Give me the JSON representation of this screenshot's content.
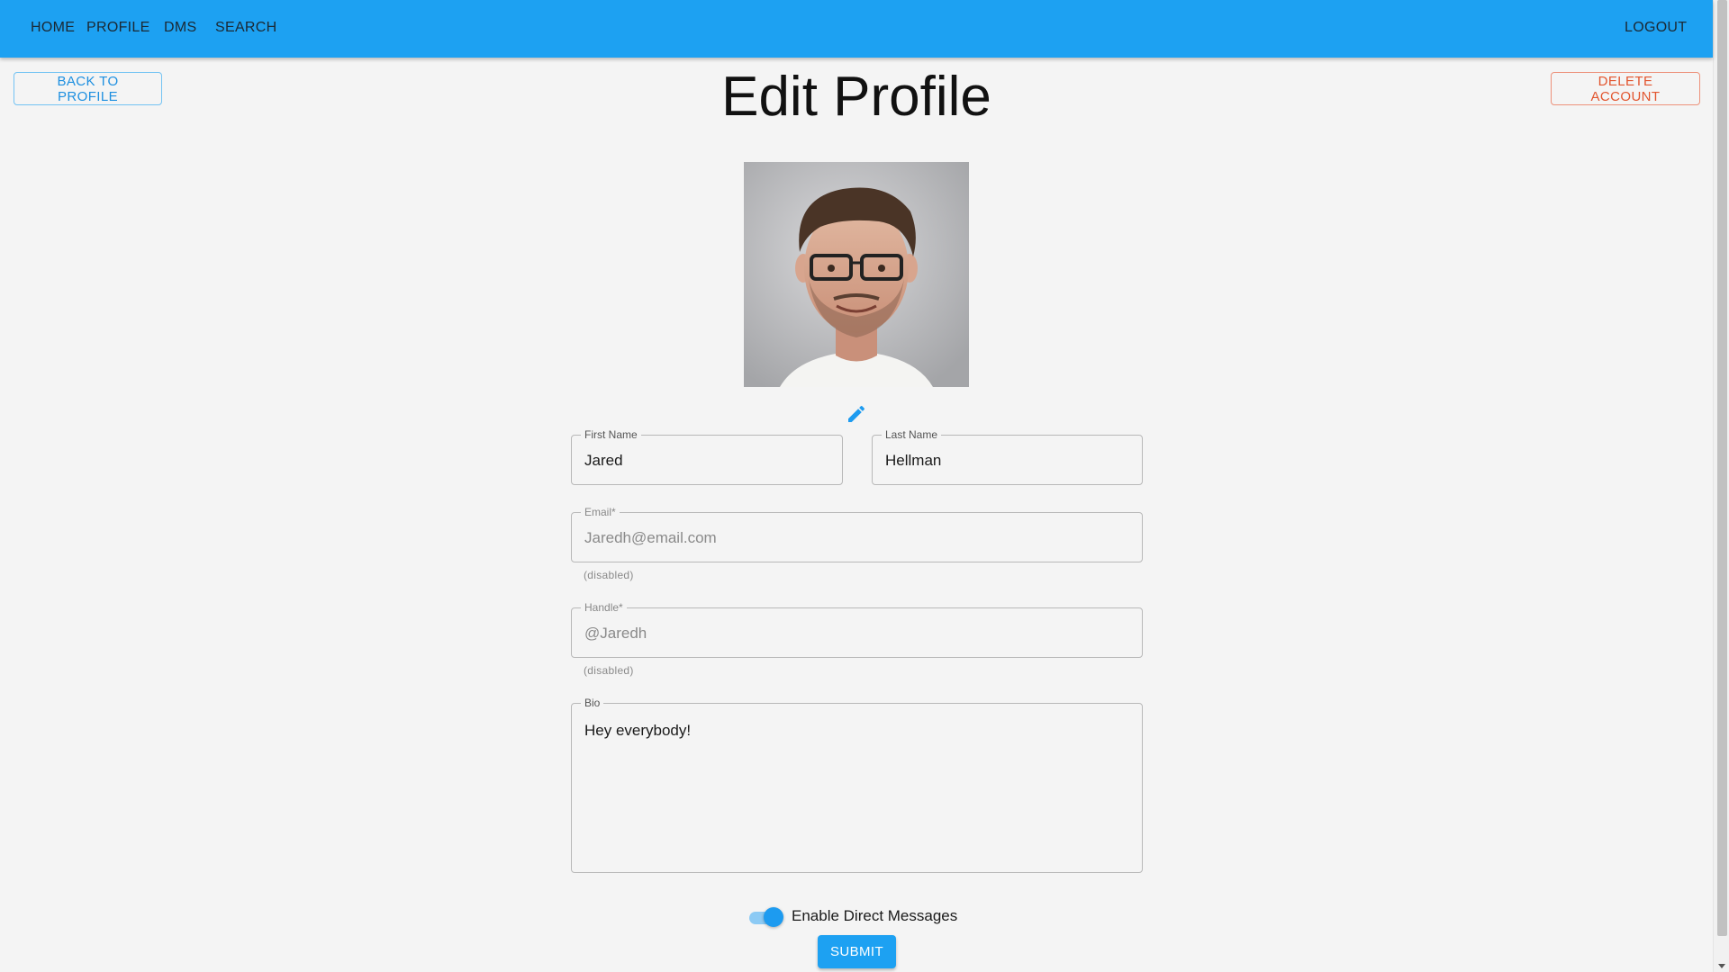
{
  "nav": {
    "home": "HOME",
    "profile": "PROFILE",
    "dms": "DMS",
    "search": "SEARCH",
    "logout": "LOGOUT"
  },
  "actions": {
    "back": "BACK TO PROFILE",
    "delete": "DELETE ACCOUNT",
    "submit": "SUBMIT"
  },
  "page": {
    "title": "Edit Profile"
  },
  "form": {
    "first_name": {
      "label": "First Name",
      "value": "Jared"
    },
    "last_name": {
      "label": "Last Name",
      "value": "Hellman"
    },
    "email": {
      "label": "Email*",
      "value": "Jaredh@email.com",
      "helper": "(disabled)"
    },
    "handle": {
      "label": "Handle*",
      "value": "@Jaredh",
      "helper": "(disabled)"
    },
    "bio": {
      "label": "Bio",
      "value": "Hey everybody!"
    },
    "dm_toggle": {
      "label": "Enable Direct Messages",
      "enabled": true
    }
  },
  "icons": {
    "edit": "pencil-icon",
    "avatar": "profile-photo"
  },
  "colors": {
    "primary": "#1da1f2",
    "danger": "#e2552e",
    "background": "#f4f4f4"
  }
}
